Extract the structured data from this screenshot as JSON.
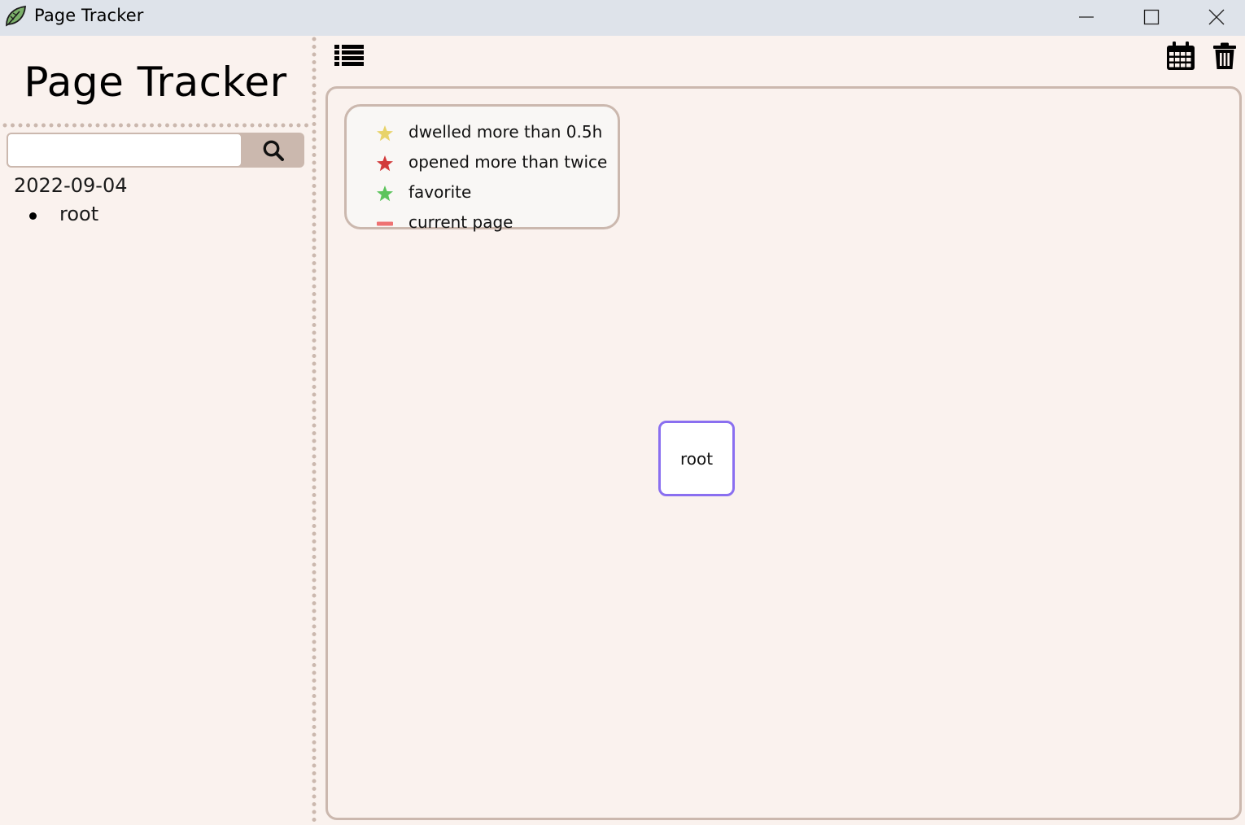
{
  "window": {
    "title": "Page Tracker"
  },
  "sidebar": {
    "title": "Page Tracker",
    "search": {
      "value": "",
      "placeholder": ""
    },
    "date": "2022-09-04",
    "items": [
      {
        "label": "root"
      }
    ]
  },
  "legend": [
    {
      "label": "dwelled more than 0.5h",
      "icon": "star-icon",
      "color": "#e8d36a"
    },
    {
      "label": "opened more than twice",
      "icon": "star-icon",
      "color": "#d23b3b"
    },
    {
      "label": "favorite",
      "icon": "star-icon",
      "color": "#5cc45c"
    },
    {
      "label": "current page",
      "icon": "dash-icon",
      "color": "#ee7272"
    }
  ],
  "graph": {
    "nodes": [
      {
        "label": "root",
        "border_color": "#8a6ff0"
      }
    ]
  },
  "colors": {
    "background": "#faf2ee",
    "accent_border": "#cbb8ae",
    "titlebar": "#dee3ea"
  }
}
